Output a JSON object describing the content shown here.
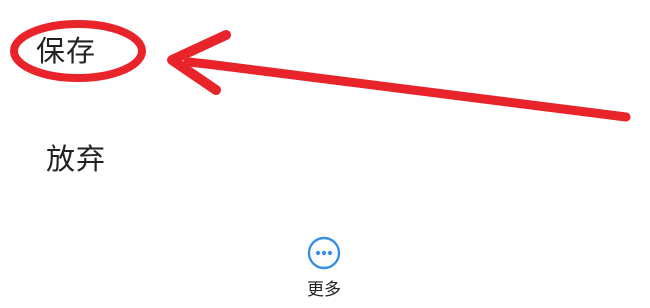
{
  "menu": {
    "save_label": "保存",
    "discard_label": "放弃"
  },
  "bottom_bar": {
    "more_label": "更多",
    "more_icon": "more-dots-icon"
  },
  "annotation": {
    "color": "#e8242a",
    "shapes": [
      "red-ellipse-highlight",
      "red-arrow"
    ]
  },
  "colors": {
    "text": "#222222",
    "accent": "#3b8fe8",
    "background": "#ffffff"
  }
}
